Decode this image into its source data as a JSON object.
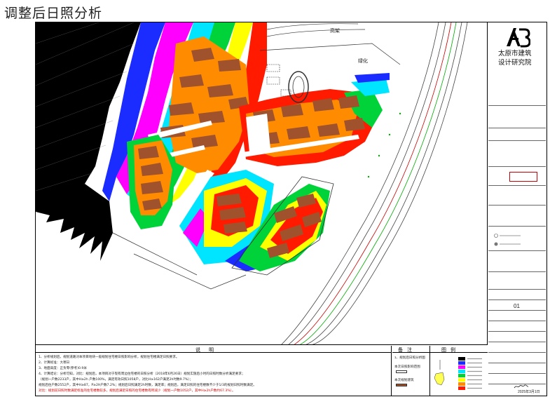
{
  "page_title": "调整后日照分析",
  "map": {
    "labels": {
      "gaojia": "高架",
      "lvhua": "绿化"
    },
    "colors": {
      "black": "#000000",
      "blue": "#1a2cff",
      "magenta": "#ff00ff",
      "cyan": "#00e5ff",
      "green": "#00d23a",
      "yellow": "#ffff00",
      "orange": "#ff8c00",
      "red": "#ff1a00",
      "building": "#a0522d"
    }
  },
  "title_block": {
    "institute_line1": "太原市建筑",
    "institute_line2": "设计研究院",
    "sheet_number": "01",
    "date": "2025年3月1日"
  },
  "notes": {
    "heading": "说明",
    "lines": [
      "1、分析规划后，规划道路对本项目地块一般规划住宅楼日照影响分析，规划住宅楼满足日照要求。",
      "2、计算标准：大寒日",
      "3、地面高度：正负零(参考)0.9米",
      "4、计算结论：分析可知，对比：规划后，本项目对于现有周边住宅楼的日照分析（2018年6月26日）规划实施后小时的日照时数分析满足要求；",
      "（规划一户数2233户，其中H≥2h 户数100%，满足有效日照1058户，对比H≥162户满足2h时数9.7%）；",
      "规划后住户数2552户，其中H≥87，P≥2H户数7.2%；规划后日照满足2h时数，满足率；规划后，满足日照的住宅楼数不少于1/3的规划日照时数满足。",
      "对比：规划前日照时数满足标准的住宅楼数较多，规划后满足日照的住宅楼数有所减少（规划一户数1052户，其中H≥2h户数约67.3%）。"
    ]
  },
  "legend": {
    "heading_a": "备注",
    "heading_b": "图例",
    "items": [
      "1、规划后日照分析图",
      "本次日照影响范围",
      "本次规划建筑"
    ]
  }
}
